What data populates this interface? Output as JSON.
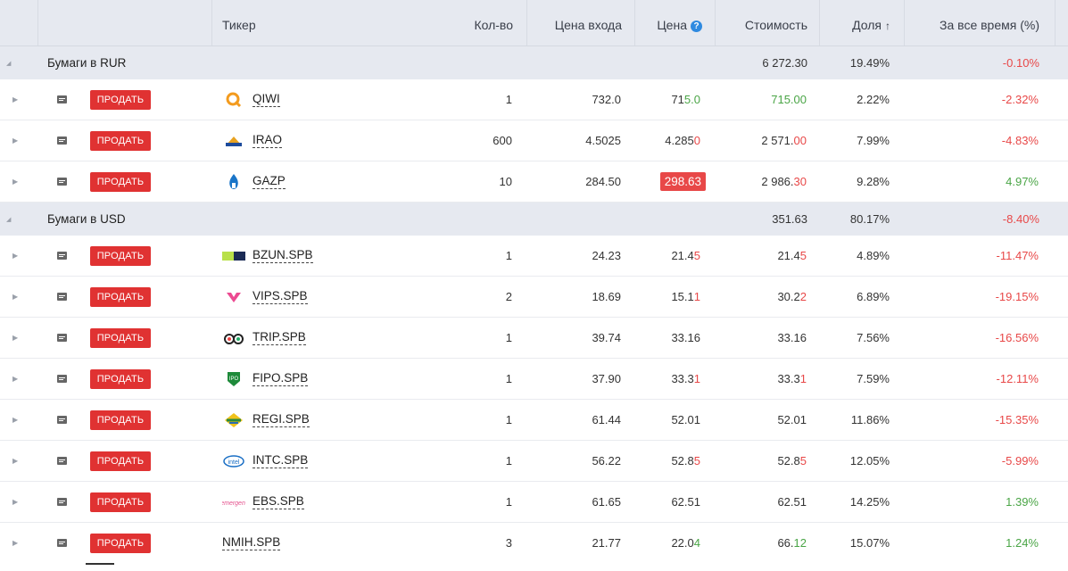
{
  "header": {
    "ticker": "Тикер",
    "qty": "Кол-во",
    "entry_price": "Цена входа",
    "price": "Цена",
    "price_info": "?",
    "value": "Стоимость",
    "share": "Доля",
    "share_sort": "↑",
    "all_time": "За все время (%)"
  },
  "sell_label": "ПРОДАТЬ",
  "groups": [
    {
      "title": "Бумаги в RUR",
      "value": "6 272.30",
      "share": "19.49%",
      "all_time": "-0.10%",
      "rows": [
        {
          "ticker": "QIWI",
          "qty": "1",
          "entry": "732.0",
          "price_a": "71",
          "price_b": "5.0",
          "value_a": "71",
          "value_b": "5.00",
          "share": "2.22%",
          "all_time": "-2.32%",
          "logo": "qiwi-logo",
          "trend": "green",
          "all_trend": "red"
        },
        {
          "ticker": "IRAO",
          "qty": "600",
          "entry": "4.5025",
          "price_a": "4.285",
          "price_b": "0",
          "value_a": "2 571.",
          "value_b": "00",
          "share": "7.99%",
          "all_time": "-4.83%",
          "logo": "inter-rao-logo",
          "trend": "red",
          "all_trend": "red"
        },
        {
          "ticker": "GAZP",
          "qty": "10",
          "entry": "284.50",
          "price_a": "",
          "price_b": "298.63",
          "value_a": "2 986.",
          "value_b": "30",
          "share": "9.28%",
          "all_time": "4.97%",
          "logo": "gazprom-logo",
          "trend": "badge",
          "all_trend": "green"
        }
      ]
    },
    {
      "title": "Бумаги в USD",
      "value": "351.63",
      "share": "80.17%",
      "all_time": "-8.40%",
      "rows": [
        {
          "ticker": "BZUN.SPB",
          "qty": "1",
          "entry": "24.23",
          "price_a": "21.4",
          "price_b": "5",
          "value_a": "21.4",
          "value_b": "5",
          "share": "4.89%",
          "all_time": "-11.47%",
          "logo": "baozun-logo",
          "trend": "red",
          "all_trend": "red"
        },
        {
          "ticker": "VIPS.SPB",
          "qty": "2",
          "entry": "18.69",
          "price_a": "15.1",
          "price_b": "1",
          "value_a": "30.2",
          "value_b": "2",
          "share": "6.89%",
          "all_time": "-19.15%",
          "logo": "vipshop-logo",
          "trend": "red",
          "all_trend": "red"
        },
        {
          "ticker": "TRIP.SPB",
          "qty": "1",
          "entry": "39.74",
          "price_a": "33.16",
          "price_b": "",
          "value_a": "33.16",
          "value_b": "",
          "share": "7.56%",
          "all_time": "-16.56%",
          "logo": "tripadvisor-logo",
          "trend": "none",
          "all_trend": "red"
        },
        {
          "ticker": "FIPO.SPB",
          "qty": "1",
          "entry": "37.90",
          "price_a": "33.3",
          "price_b": "1",
          "value_a": "33.3",
          "value_b": "1",
          "share": "7.59%",
          "all_time": "-12.11%",
          "logo": "fipo-logo",
          "trend": "red",
          "all_trend": "red"
        },
        {
          "ticker": "REGI.SPB",
          "qty": "1",
          "entry": "61.44",
          "price_a": "52.01",
          "price_b": "",
          "value_a": "52.01",
          "value_b": "",
          "share": "11.86%",
          "all_time": "-15.35%",
          "logo": "regi-logo",
          "trend": "none",
          "all_trend": "red"
        },
        {
          "ticker": "INTC.SPB",
          "qty": "1",
          "entry": "56.22",
          "price_a": "52.8",
          "price_b": "5",
          "value_a": "52.8",
          "value_b": "5",
          "share": "12.05%",
          "all_time": "-5.99%",
          "logo": "intel-logo",
          "trend": "red",
          "all_trend": "red"
        },
        {
          "ticker": "EBS.SPB",
          "qty": "1",
          "entry": "61.65",
          "price_a": "62.51",
          "price_b": "",
          "value_a": "62.51",
          "value_b": "",
          "share": "14.25%",
          "all_time": "1.39%",
          "logo": "emergent-logo",
          "trend": "none",
          "all_trend": "green"
        },
        {
          "ticker": "NMIH.SPB",
          "qty": "3",
          "entry": "21.77",
          "price_a": "22.0",
          "price_b": "4",
          "value_a": "66.",
          "value_b": "12",
          "share": "15.07%",
          "all_time": "1.24%",
          "logo": "none",
          "trend": "green",
          "all_trend": "green"
        }
      ]
    }
  ],
  "colors": {
    "red": "#e84848",
    "green": "#4aa546",
    "sell": "#e03232",
    "info": "#2f8ae0"
  }
}
